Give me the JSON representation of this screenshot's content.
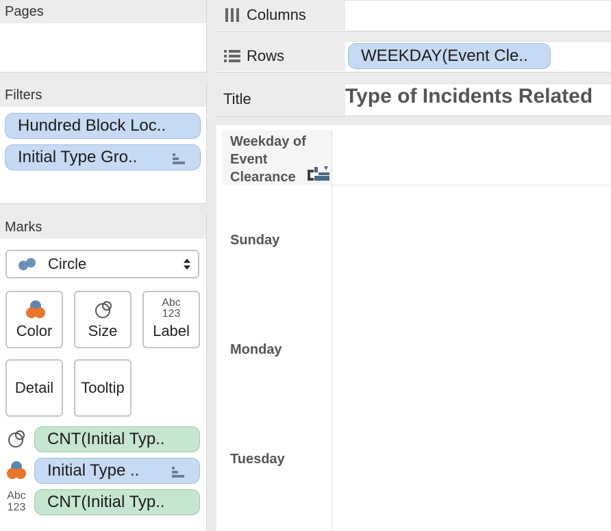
{
  "pages": {
    "header": "Pages"
  },
  "filters": {
    "header": "Filters",
    "items": [
      {
        "label": "Hundred Block Loc.."
      },
      {
        "label": "Initial Type Gro.."
      }
    ]
  },
  "marks": {
    "header": "Marks",
    "mark_type": "Circle",
    "buttons": {
      "color": "Color",
      "size": "Size",
      "label": "Label",
      "detail": "Detail",
      "tooltip": "Tooltip"
    },
    "label_icon_top": "Abc",
    "label_icon_bottom": "123",
    "fields": [
      {
        "label": "CNT(Initial Typ..",
        "kind": "size"
      },
      {
        "label": "Initial Type ..",
        "kind": "color"
      },
      {
        "label": "CNT(Initial Typ..",
        "kind": "label"
      }
    ]
  },
  "shelves": {
    "columns_label": "Columns",
    "rows_label": "Rows",
    "rows_pill": "WEEKDAY(Event Cle..",
    "title_label": "Title",
    "title_text": "Type of Incidents Related"
  },
  "view": {
    "row_header_title": "Weekday of Event Clearance",
    "rows": [
      "Sunday",
      "Monday",
      "Tuesday"
    ]
  },
  "colors": {
    "blue_pill": "#c7daf3",
    "green_pill": "#c6e6cf",
    "orange": "#e8762c",
    "steel_blue": "#5b87b0"
  }
}
